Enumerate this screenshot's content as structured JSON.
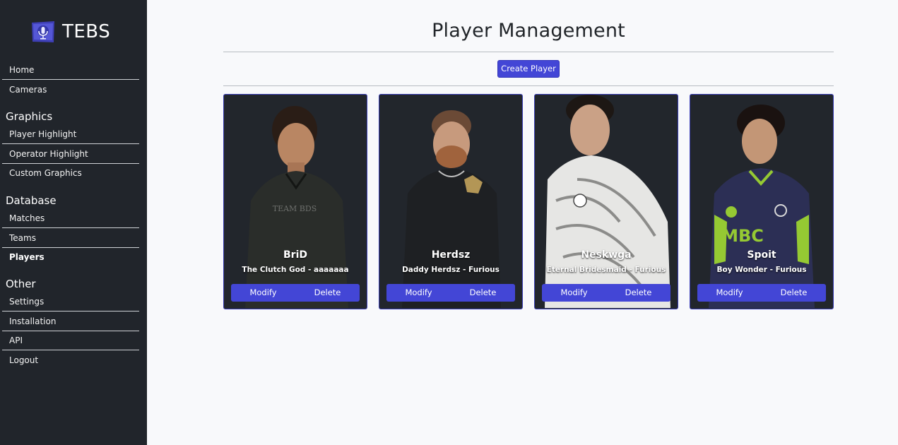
{
  "app": {
    "name": "TEBS"
  },
  "sidebar": {
    "top_items": [
      {
        "label": "Home"
      },
      {
        "label": "Cameras"
      }
    ],
    "sections": [
      {
        "title": "Graphics",
        "items": [
          {
            "label": "Player Highlight"
          },
          {
            "label": "Operator Highlight"
          },
          {
            "label": "Custom Graphics"
          }
        ]
      },
      {
        "title": "Database",
        "items": [
          {
            "label": "Matches"
          },
          {
            "label": "Teams"
          },
          {
            "label": "Players"
          }
        ]
      },
      {
        "title": "Other",
        "items": [
          {
            "label": "Settings"
          },
          {
            "label": "Installation"
          },
          {
            "label": "API"
          },
          {
            "label": "Logout"
          }
        ]
      }
    ],
    "active_item": "Players"
  },
  "main": {
    "title": "Player Management",
    "create_label": "Create Player",
    "players": [
      {
        "name": "BriD",
        "tagline": "The Clutch God - aaaaaaa",
        "modify_label": "Modify",
        "delete_label": "Delete",
        "jersey_color": "#2a2d2a"
      },
      {
        "name": "Herdsz",
        "tagline": "Daddy Herdsz - Furious",
        "modify_label": "Modify",
        "delete_label": "Delete",
        "jersey_color": "#1e2023"
      },
      {
        "name": "Neskwga",
        "tagline": "Eternal Bridesmaid - Furious",
        "modify_label": "Modify",
        "delete_label": "Delete",
        "jersey_color": "#e6e6e4"
      },
      {
        "name": "Spoit",
        "tagline": "Boy Wonder - Furious",
        "modify_label": "Modify",
        "delete_label": "Delete",
        "jersey_color": "#2c2f55"
      }
    ]
  },
  "colors": {
    "sidebar_bg": "#21252b",
    "accent": "#4346d6",
    "card_bg": "#22262c",
    "page_bg": "#f8f9fb"
  }
}
